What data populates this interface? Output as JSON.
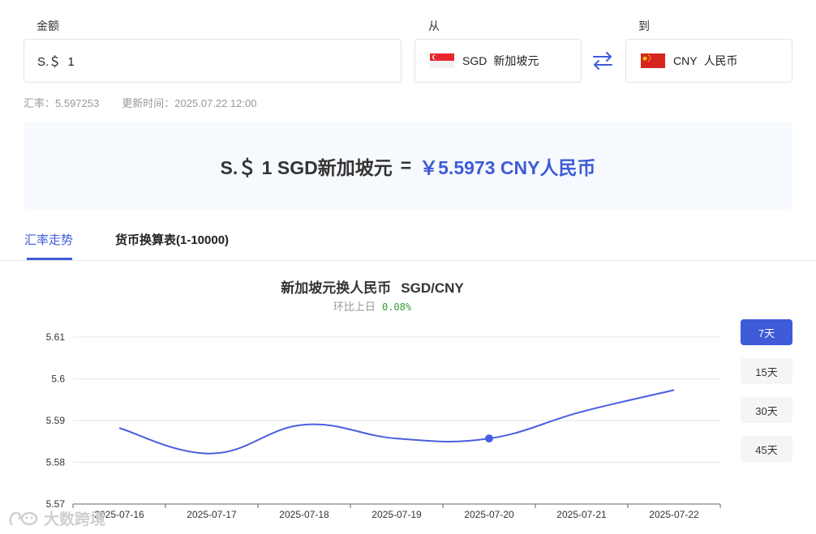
{
  "form": {
    "amount_label": "金额",
    "amount_value": "S.＄  1",
    "from_label": "从",
    "to_label": "到",
    "from_code": "SGD",
    "from_name": "新加坡元",
    "to_code": "CNY",
    "to_name": "人民币"
  },
  "rate_info": {
    "rate": "汇率：5.597253",
    "updated": "更新时间：2025.07.22 12:00"
  },
  "result": {
    "left": "S.＄ 1 SGD新加坡元",
    "equals": "=",
    "right": "￥5.5973 CNY人民币"
  },
  "tabs": [
    {
      "label": "汇率走势",
      "active": true
    },
    {
      "label": "货币换算表(1-10000)",
      "active": false
    }
  ],
  "chart": {
    "title": "新加坡元换人民币",
    "pair": "SGD/CNY",
    "change_label": "环比上日",
    "change_value": "0.08%"
  },
  "range_buttons": [
    {
      "label": "7天",
      "active": true
    },
    {
      "label": "15天",
      "active": false
    },
    {
      "label": "30天",
      "active": false
    },
    {
      "label": "45天",
      "active": false
    }
  ],
  "chart_data": {
    "type": "line",
    "title": "新加坡元换人民币  SGD/CNY",
    "categories": [
      "2025-07-16",
      "2025-07-17",
      "2025-07-18",
      "2025-07-19",
      "2025-07-20",
      "2025-07-21",
      "2025-07-22"
    ],
    "series": [
      {
        "values": [
          5.5882,
          5.5821,
          5.589,
          5.5857,
          5.5857,
          5.5921,
          5.5973
        ]
      }
    ],
    "yticks": [
      5.57,
      5.58,
      5.59,
      5.6,
      5.61
    ],
    "ytick_labels": [
      "5.57",
      "5.58",
      "5.59",
      "5.6",
      "5.61"
    ],
    "ylim": [
      5.57,
      5.61
    ],
    "grid": true,
    "highlight_index": 4,
    "colors": {
      "line": "#4a5ee0",
      "grid": "#e6e6e6",
      "axis": "#666666"
    }
  },
  "watermark": {
    "text": "大数跨境"
  },
  "colors": {
    "accent": "#3f5bd8",
    "positive": "#3a9c3a"
  }
}
